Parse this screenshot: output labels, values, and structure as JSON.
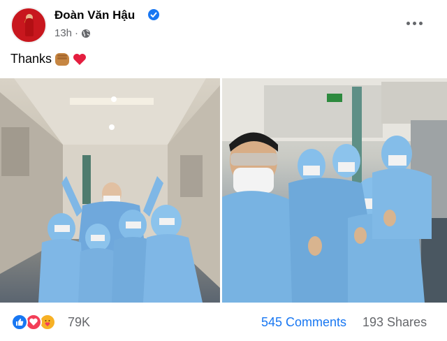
{
  "post": {
    "author": "Đoàn Văn Hậu",
    "time": "13h",
    "separator": "·",
    "privacy_icon": "globe-icon",
    "more_icon": "more-options-icon",
    "verified_icon": "verified-badge-icon",
    "caption_text": "Thanks",
    "caption_emojis": [
      "fist-bump-emoji",
      "red-heart-emoji"
    ]
  },
  "photos": [
    {
      "name": "photo-left",
      "subject": "group-in-ppe-aircraft-cabin"
    },
    {
      "name": "photo-right",
      "subject": "selfie-group-in-ppe-aircraft-cabin"
    }
  ],
  "engagement": {
    "reaction_icons": [
      "like-icon",
      "love-icon",
      "care-icon"
    ],
    "reaction_count": "79K",
    "comments": "545 Comments",
    "shares": "193 Shares"
  },
  "colors": {
    "accent": "#1877f2",
    "secondary_text": "#65676b",
    "ppe_blue": "#7fb7e6",
    "love_red": "#f33e58",
    "care_yellow": "#f7b125"
  }
}
